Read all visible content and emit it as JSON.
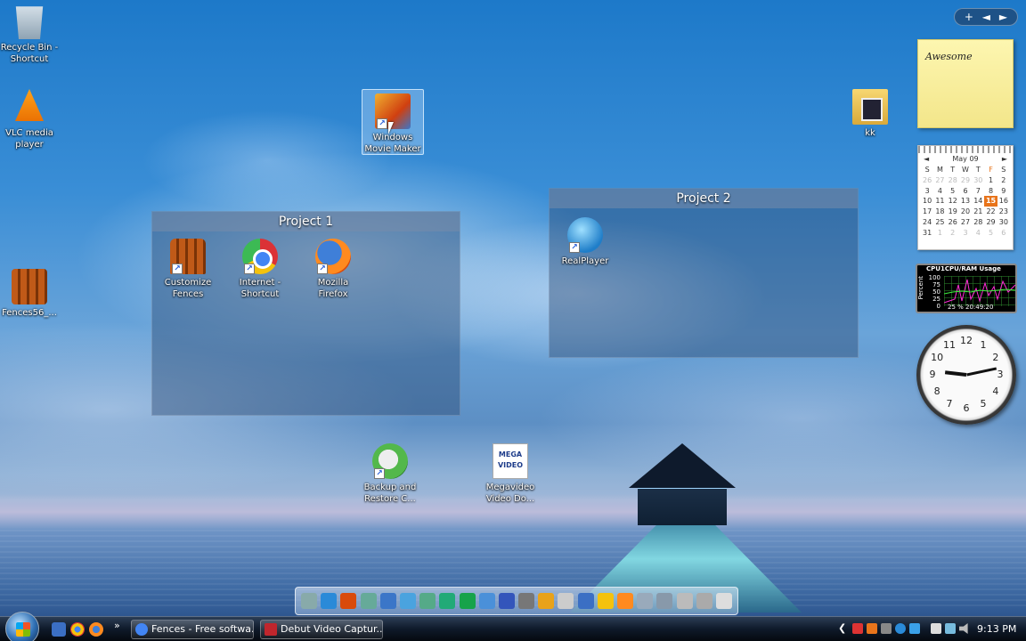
{
  "desktop": {
    "icons": {
      "recycle": "Recycle Bin - Shortcut",
      "vlc": "VLC media player",
      "fences_file": "Fences56_...",
      "wmm": "Windows Movie Maker",
      "kk": "kk",
      "backup": "Backup and Restore C...",
      "megavideo": "Megavideo Video Do..."
    },
    "mega_logo": "MEGA VIDEO"
  },
  "fences": {
    "project1": {
      "title": "Project 1",
      "items": [
        "Customize Fences",
        "Internet - Shortcut",
        "Mozilla Firefox"
      ]
    },
    "project2": {
      "title": "Project 2",
      "items": [
        "RealPlayer"
      ]
    }
  },
  "gadgets": {
    "controls": {
      "add": "+",
      "prev": "◄",
      "next": "►"
    },
    "note": "Awesome",
    "calendar": {
      "month": "May 09",
      "prev": "◄",
      "next": "►",
      "weekdays": [
        "S",
        "M",
        "T",
        "W",
        "T",
        "F",
        "S"
      ],
      "days": [
        {
          "d": "26",
          "dim": true
        },
        {
          "d": "27",
          "dim": true
        },
        {
          "d": "28",
          "dim": true
        },
        {
          "d": "29",
          "dim": true
        },
        {
          "d": "30",
          "dim": true
        },
        {
          "d": "1"
        },
        {
          "d": "2"
        },
        {
          "d": "3"
        },
        {
          "d": "4"
        },
        {
          "d": "5"
        },
        {
          "d": "6"
        },
        {
          "d": "7"
        },
        {
          "d": "8"
        },
        {
          "d": "9"
        },
        {
          "d": "10"
        },
        {
          "d": "11"
        },
        {
          "d": "12"
        },
        {
          "d": "13"
        },
        {
          "d": "14"
        },
        {
          "d": "15",
          "today": true
        },
        {
          "d": "16"
        },
        {
          "d": "17"
        },
        {
          "d": "18"
        },
        {
          "d": "19"
        },
        {
          "d": "20"
        },
        {
          "d": "21"
        },
        {
          "d": "22"
        },
        {
          "d": "23"
        },
        {
          "d": "24"
        },
        {
          "d": "25"
        },
        {
          "d": "26"
        },
        {
          "d": "27"
        },
        {
          "d": "28"
        },
        {
          "d": "29"
        },
        {
          "d": "30"
        },
        {
          "d": "31"
        },
        {
          "d": "1",
          "dim": true
        },
        {
          "d": "2",
          "dim": true
        },
        {
          "d": "3",
          "dim": true
        },
        {
          "d": "4",
          "dim": true
        },
        {
          "d": "5",
          "dim": true
        },
        {
          "d": "6",
          "dim": true
        }
      ]
    },
    "cpu": {
      "title": "CPU1CPU/RAM Usage",
      "ylabel": "Percent",
      "ticks": [
        "100",
        "75",
        "50",
        "25",
        "0"
      ],
      "footer": "25 % 20:49:20"
    },
    "clock": {
      "numbers": [
        "12",
        "1",
        "2",
        "3",
        "4",
        "5",
        "6",
        "7",
        "8",
        "9",
        "10",
        "11"
      ],
      "hour": 9,
      "minute": 13
    }
  },
  "taskbar": {
    "buttons": [
      {
        "label": "Fences - Free softwa...",
        "color": "#4285f4"
      },
      {
        "label": "Debut Video Captur...",
        "color": "#c0262d"
      }
    ],
    "chevron": "»",
    "tray_arrow": "❮",
    "time": "9:13 PM"
  }
}
